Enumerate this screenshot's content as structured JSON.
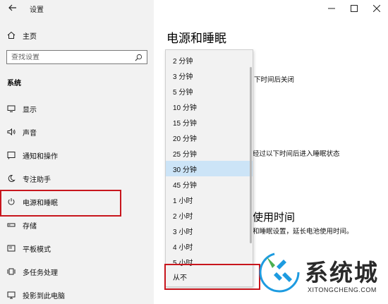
{
  "app": {
    "title": "设置",
    "page_title": "电源和睡眠"
  },
  "sidebar": {
    "home_label": "主页",
    "search_placeholder": "查找设置",
    "section_label": "系统",
    "items": [
      {
        "label": "显示",
        "icon": "monitor-icon"
      },
      {
        "label": "声音",
        "icon": "speaker-icon"
      },
      {
        "label": "通知和操作",
        "icon": "notification-icon"
      },
      {
        "label": "专注助手",
        "icon": "moon-icon"
      },
      {
        "label": "电源和睡眠",
        "icon": "power-icon"
      },
      {
        "label": "存储",
        "icon": "storage-icon"
      },
      {
        "label": "平板模式",
        "icon": "tablet-icon"
      },
      {
        "label": "多任务处理",
        "icon": "multitask-icon"
      },
      {
        "label": "投影到此电脑",
        "icon": "project-icon"
      }
    ]
  },
  "main": {
    "screen_text": "下时间后关闭",
    "sleep_text": "经过以下时间后进入睡眠状态",
    "section_head": "使用时间",
    "battery_text": "和睡眠设置，延长电池使用时间。"
  },
  "dropdown": {
    "options": [
      "2 分钟",
      "3 分钟",
      "5 分钟",
      "10 分钟",
      "15 分钟",
      "20 分钟",
      "25 分钟",
      "30 分钟",
      "45 分钟",
      "1 小时",
      "2 小时",
      "3 小时",
      "4 小时",
      "5 小时",
      "从不"
    ],
    "selected": "30 分钟"
  },
  "watermark": {
    "text": "系统城",
    "domain": "XITONGCHENG.COM"
  },
  "colors": {
    "accent": "#cce4f7",
    "highlight": "#c8161d",
    "sidebar_bg": "#f2f2f2",
    "logo_blue": "#1d9be0",
    "logo_green": "#4caf50"
  }
}
